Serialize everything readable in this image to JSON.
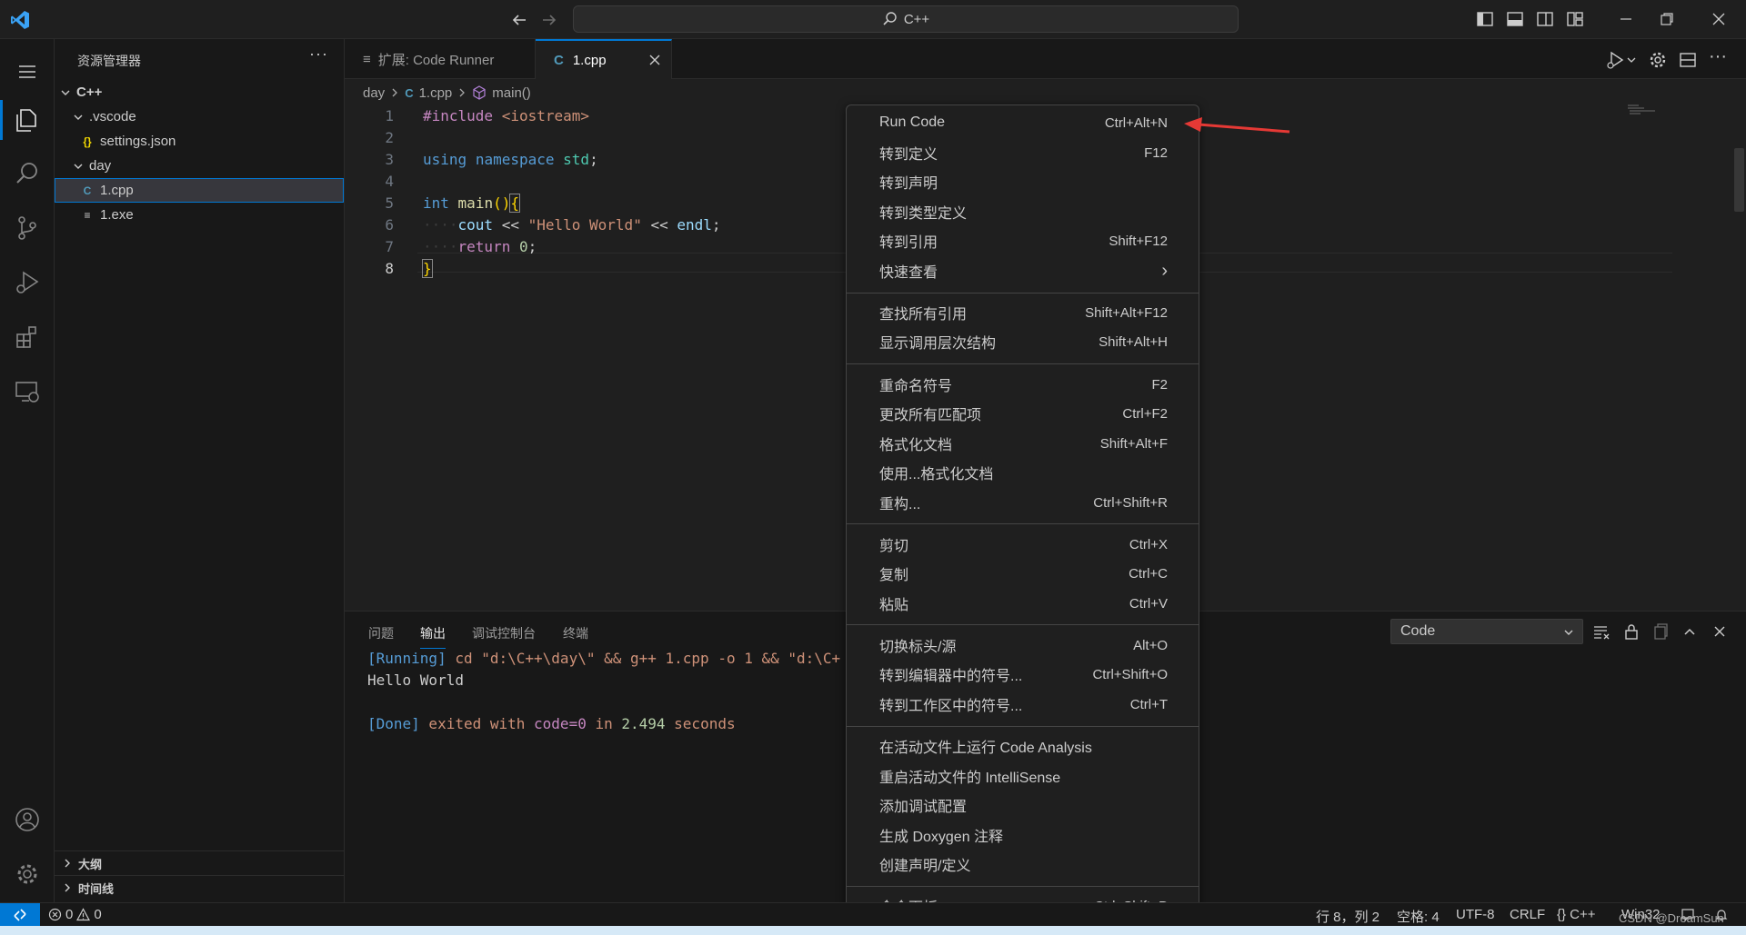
{
  "titlebar": {
    "search_text": "C++"
  },
  "sidebar": {
    "title": "资源管理器",
    "more": "···",
    "tree": [
      {
        "label": "C++",
        "kind": "folder"
      },
      {
        "label": ".vscode",
        "kind": "folder"
      },
      {
        "label": "settings.json",
        "kind": "json",
        "icon": "{}"
      },
      {
        "label": "day",
        "kind": "folder"
      },
      {
        "label": "1.cpp",
        "kind": "cpp",
        "icon": "C"
      },
      {
        "label": "1.exe",
        "kind": "file",
        "icon": "≡"
      }
    ],
    "outline": "大纲",
    "timeline": "时间线"
  },
  "tabs": [
    {
      "label": "扩展: Code Runner",
      "icon": "≡"
    },
    {
      "label": "1.cpp",
      "icon": "C"
    }
  ],
  "breadcrumb": [
    "day",
    "1.cpp",
    "main()"
  ],
  "editor": {
    "line_numbers": [
      "1",
      "2",
      "3",
      "4",
      "5",
      "6",
      "7",
      "8"
    ]
  },
  "panel": {
    "tabs": [
      "问题",
      "输出",
      "调试控制台",
      "终端"
    ],
    "output_channel": "Code",
    "output": {
      "running_tag": "[Running]",
      "running_cmd": " cd \"d:\\C++\\day\\\" && g++ 1.cpp -o 1 && \"d:\\C+",
      "hello": "Hello World",
      "done_tag": "[Done]",
      "done_1": " exited with ",
      "done_code": "code=0",
      "done_2": " in ",
      "done_secs": "2.494",
      "done_3": " seconds"
    }
  },
  "context_menu": {
    "items": [
      {
        "label": "Run Code",
        "shortcut": "Ctrl+Alt+N"
      },
      {
        "label": "转到定义",
        "shortcut": "F12"
      },
      {
        "label": "转到声明",
        "shortcut": ""
      },
      {
        "label": "转到类型定义",
        "shortcut": ""
      },
      {
        "label": "转到引用",
        "shortcut": "Shift+F12"
      },
      {
        "label": "快速查看",
        "shortcut": "›"
      },
      {
        "label": "查找所有引用",
        "shortcut": "Shift+Alt+F12"
      },
      {
        "label": "显示调用层次结构",
        "shortcut": "Shift+Alt+H"
      },
      {
        "label": "重命名符号",
        "shortcut": "F2"
      },
      {
        "label": "更改所有匹配项",
        "shortcut": "Ctrl+F2"
      },
      {
        "label": "格式化文档",
        "shortcut": "Shift+Alt+F"
      },
      {
        "label": "使用...格式化文档",
        "shortcut": ""
      },
      {
        "label": "重构...",
        "shortcut": "Ctrl+Shift+R"
      },
      {
        "label": "剪切",
        "shortcut": "Ctrl+X"
      },
      {
        "label": "复制",
        "shortcut": "Ctrl+C"
      },
      {
        "label": "粘贴",
        "shortcut": "Ctrl+V"
      },
      {
        "label": "切换标头/源",
        "shortcut": "Alt+O"
      },
      {
        "label": "转到编辑器中的符号...",
        "shortcut": "Ctrl+Shift+O"
      },
      {
        "label": "转到工作区中的符号...",
        "shortcut": "Ctrl+T"
      },
      {
        "label": "在活动文件上运行 Code Analysis",
        "shortcut": ""
      },
      {
        "label": "重启活动文件的 IntelliSense",
        "shortcut": ""
      },
      {
        "label": "添加调试配置",
        "shortcut": ""
      },
      {
        "label": "生成 Doxygen 注释",
        "shortcut": ""
      },
      {
        "label": "创建声明/定义",
        "shortcut": ""
      },
      {
        "label": "命令面板...",
        "shortcut": "Ctrl+Shift+P"
      }
    ]
  },
  "statusbar": {
    "errors": "0",
    "warnings": "0",
    "position": "行 8，列 2",
    "spaces": "空格: 4",
    "encoding": "UTF-8",
    "eol": "CRLF",
    "language": "{} C++",
    "platform": "Win32"
  },
  "watermark": "CSDN @DreamSun",
  "colors": {
    "accent": "#0078d4",
    "annotation_arrow": "#e53935"
  }
}
